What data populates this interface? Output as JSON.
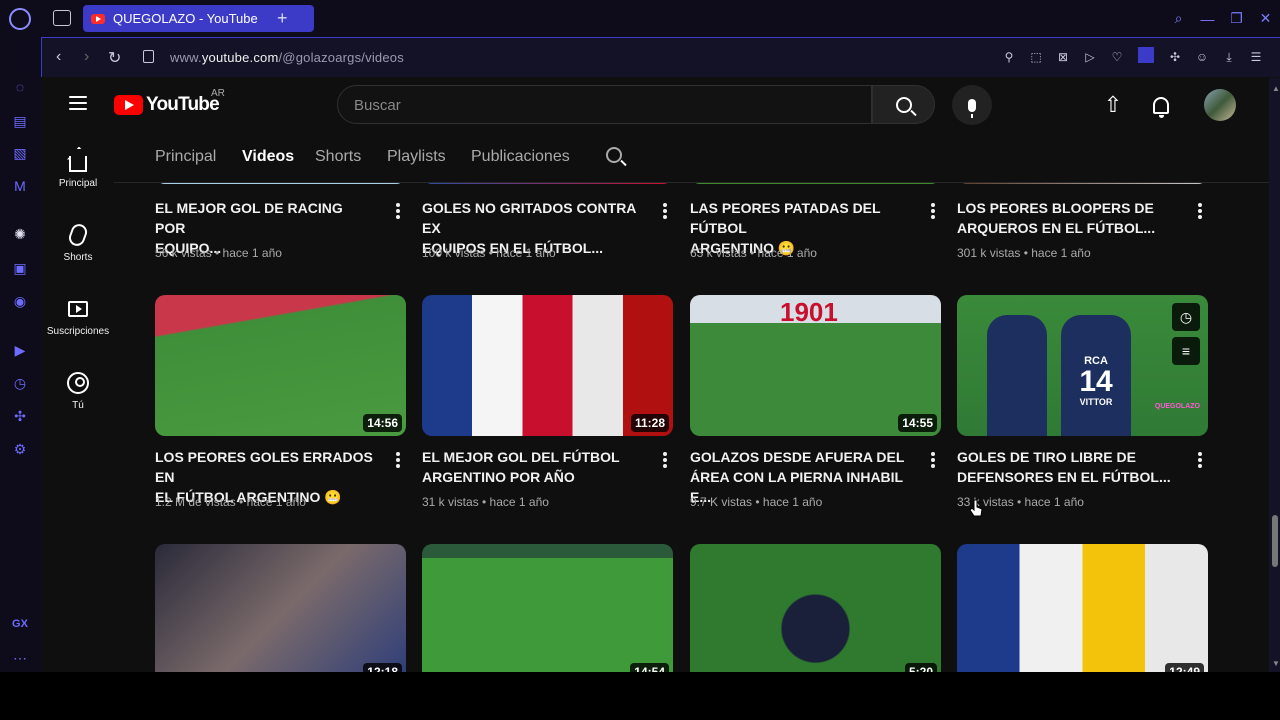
{
  "browser": {
    "tab_title": "QUEGOLAZO - YouTube",
    "url_prefix": "www.",
    "url_main": "youtube.com",
    "url_path": "/@golazoargs/videos",
    "gx_label": "GX"
  },
  "header": {
    "logo_word": "YouTube",
    "country": "AR",
    "search_placeholder": "Buscar"
  },
  "sidebar": {
    "items": [
      {
        "label": "Principal",
        "icon": "home-icon"
      },
      {
        "label": "Shorts",
        "icon": "shorts-icon"
      },
      {
        "label": "Suscripciones",
        "icon": "subscriptions-icon"
      },
      {
        "label": "Tú",
        "icon": "you-icon"
      }
    ]
  },
  "channel_tabs": [
    "Principal",
    "Videos",
    "Shorts",
    "Playlists",
    "Publicaciones"
  ],
  "active_tab": "Videos",
  "videos": [
    {
      "title1": "EL MEJOR GOL DE RACING POR",
      "title2": "EQUIPO...",
      "meta": "56 k vistas • hace 1 año"
    },
    {
      "title1": "GOLES NO GRITADOS CONTRA EX",
      "title2": "EQUIPOS EN EL FÚTBOL...",
      "meta": "100 k vistas • hace 1 año"
    },
    {
      "title1": "LAS PEORES PATADAS DEL FÚTBOL",
      "title2": "ARGENTINO 😬",
      "meta": "63 k vistas • hace 1 año"
    },
    {
      "title1": "LOS PEORES BLOOPERS DE",
      "title2": "ARQUEROS EN EL FÚTBOL...",
      "meta": "301 k vistas • hace 1 año"
    },
    {
      "title1": "LOS PEORES GOLES ERRADOS EN",
      "title2": "EL FÚTBOL ARGENTINO 😬",
      "meta": "1.2 M de vistas • hace 1 año",
      "duration": "14:56"
    },
    {
      "title1": "EL MEJOR GOL DEL FÚTBOL",
      "title2": "ARGENTINO POR AÑO",
      "meta": "31 k vistas • hace 1 año",
      "duration": "11:28"
    },
    {
      "title1": "GOLAZOS DESDE AFUERA DEL",
      "title2": "ÁREA CON LA PIERNA INHABIL E...",
      "meta": "9.7 K vistas • hace 1 año",
      "duration": "14:55"
    },
    {
      "title1": "GOLES DE TIRO LIBRE DE",
      "title2": "DEFENSORES EN EL FÚTBOL...",
      "meta": "33 k vistas • hace 1 año"
    },
    {
      "duration": "12:18"
    },
    {
      "duration": "14:54"
    },
    {
      "duration": "5:20"
    },
    {
      "duration": "12:49"
    }
  ],
  "thumb_text": {
    "v7_banner": "1901",
    "v8_jersey_brand": "RCA",
    "v8_number": "14",
    "v8_name": "VITTOR",
    "v8_watermark": "QUEGOLAZO"
  },
  "colors": {
    "yt_red": "#ff0000",
    "opera_accent": "#3c3bc8",
    "bg": "#0f0f0f"
  }
}
